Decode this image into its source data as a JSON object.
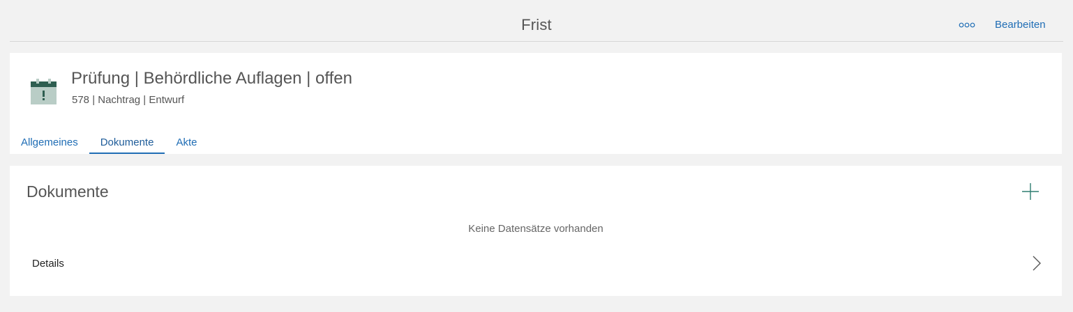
{
  "topbar": {
    "title": "Frist",
    "more_icon": "more-icon",
    "edit_label": "Bearbeiten"
  },
  "record": {
    "icon": "calendar-alert-icon",
    "title": "Prüfung | Behördliche Auflagen | offen",
    "subtitle": "578 | Nachtrag | Entwurf"
  },
  "tabs": [
    {
      "label": "Allgemeines",
      "active": false
    },
    {
      "label": "Dokumente",
      "active": true
    },
    {
      "label": "Akte",
      "active": false
    }
  ],
  "documents": {
    "title": "Dokumente",
    "add_icon": "plus-icon",
    "empty_text": "Keine Datensätze vorhanden",
    "details_label": "Details",
    "details_icon": "chevron-right-icon"
  },
  "colors": {
    "accent": "#1f6db5",
    "icon_dark_green": "#2e5e50",
    "icon_light": "#b9cdc6",
    "background": "#f2f2f2",
    "card": "#ffffff"
  }
}
